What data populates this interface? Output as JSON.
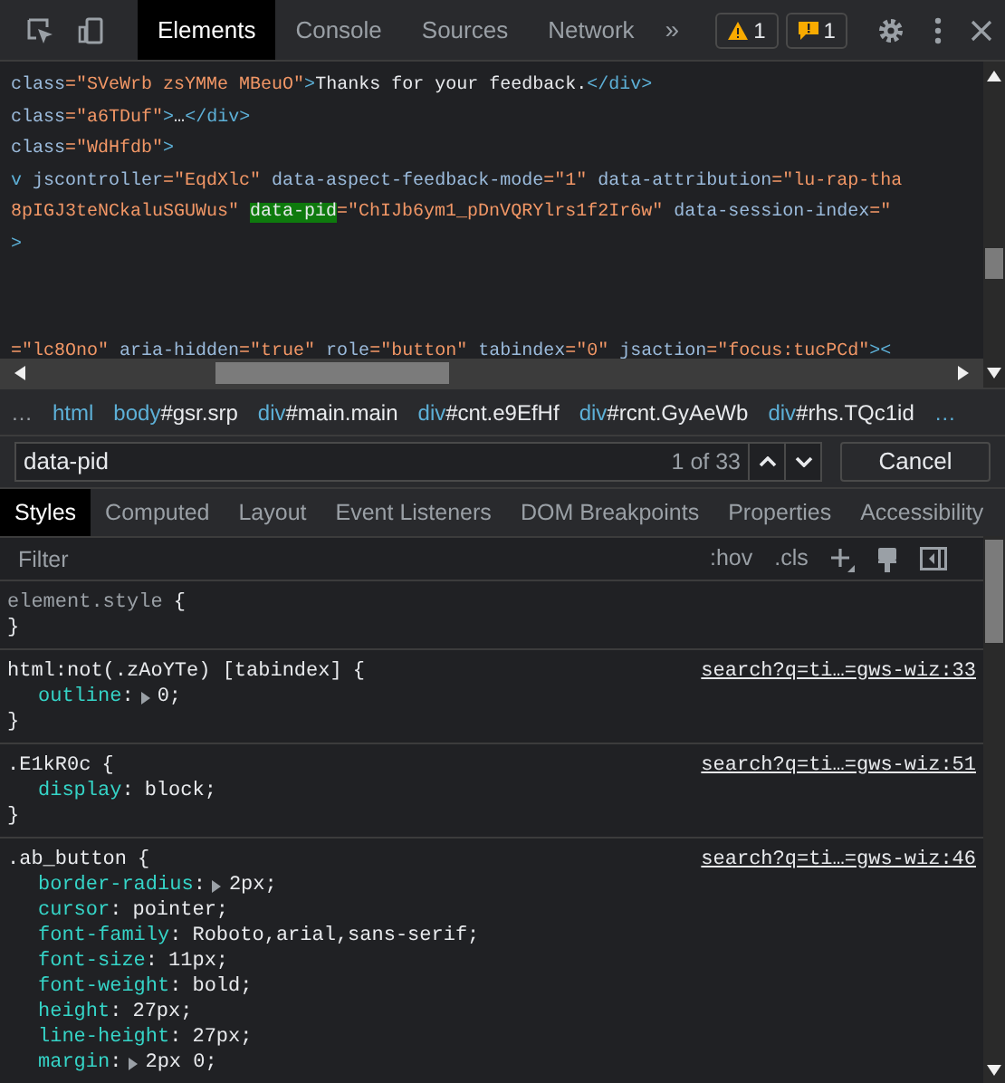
{
  "toolbar": {
    "tabs": [
      {
        "label": "Elements",
        "selected": true
      },
      {
        "label": "Console",
        "selected": false
      },
      {
        "label": "Sources",
        "selected": false
      },
      {
        "label": "Network",
        "selected": false
      }
    ],
    "more": "»",
    "warnings": "1",
    "issues": "1"
  },
  "dom_lines": [
    [
      {
        "kind": "attr",
        "text": "class"
      },
      {
        "kind": "value",
        "text": "=\"SVeWrb zsYMMe MBeuO\""
      },
      {
        "kind": "tag",
        "text": ">"
      },
      {
        "kind": "text",
        "text": "Thanks for your feedback."
      },
      {
        "kind": "tag",
        "text": "</div>"
      }
    ],
    [
      {
        "kind": "attr",
        "text": "class"
      },
      {
        "kind": "value",
        "text": "=\"a6TDuf\""
      },
      {
        "kind": "tag",
        "text": ">"
      },
      {
        "kind": "text",
        "text": "…"
      },
      {
        "kind": "tag",
        "text": "</div>"
      }
    ],
    [
      {
        "kind": "attr",
        "text": "class"
      },
      {
        "kind": "value",
        "text": "=\"WdHfdb\""
      },
      {
        "kind": "tag",
        "text": ">"
      }
    ],
    [
      {
        "kind": "tag",
        "text": "v"
      },
      {
        "kind": "attr",
        "text": " jscontroller"
      },
      {
        "kind": "value",
        "text": "=\"EqdXlc\""
      },
      {
        "kind": "attr",
        "text": " data-aspect-feedback-mode"
      },
      {
        "kind": "value",
        "text": "=\"1\""
      },
      {
        "kind": "attr",
        "text": " data-attribution"
      },
      {
        "kind": "value",
        "text": "=\"lu-rap-tha"
      }
    ],
    [
      {
        "kind": "value",
        "text": "8pIGJ3teNCkaluSGUWus\" "
      },
      {
        "kind": "match",
        "text": "data-pid"
      },
      {
        "kind": "value",
        "text": "=\"ChIJb6ym1_pDnVQRYlrs1f2Ir6w\""
      },
      {
        "kind": "attr",
        "text": " data-session-index"
      },
      {
        "kind": "value",
        "text": "=\""
      }
    ],
    [
      {
        "kind": "tag",
        "text": ">"
      }
    ]
  ],
  "dom_last_line": [
    {
      "kind": "value",
      "text": "=\"lc8Ono\""
    },
    {
      "kind": "attr",
      "text": " aria-hidden"
    },
    {
      "kind": "value",
      "text": "=\"true\""
    },
    {
      "kind": "attr",
      "text": " role"
    },
    {
      "kind": "value",
      "text": "=\"button\""
    },
    {
      "kind": "attr",
      "text": " tabindex"
    },
    {
      "kind": "value",
      "text": "=\"0\""
    },
    {
      "kind": "attr",
      "text": " jsaction"
    },
    {
      "kind": "value",
      "text": "=\"focus:tucPCd\""
    },
    {
      "kind": "tag",
      "text": "><"
    }
  ],
  "breadcrumbs": {
    "more_left": "…",
    "more_right": "…",
    "items": [
      {
        "tag": "html"
      },
      {
        "tag": "body",
        "rest": "#gsr.srp"
      },
      {
        "tag": "div",
        "rest": "#main.main"
      },
      {
        "tag": "div",
        "rest": "#cnt.e9EfHf"
      },
      {
        "tag": "div",
        "rest": "#rcnt.GyAeWb"
      },
      {
        "tag": "div",
        "rest": "#rhs.TQc1id"
      }
    ]
  },
  "search": {
    "value": "data-pid",
    "count": "1 of 33",
    "cancel": "Cancel"
  },
  "style_tabs": [
    {
      "label": "Styles",
      "selected": true
    },
    {
      "label": "Computed",
      "selected": false
    },
    {
      "label": "Layout",
      "selected": false
    },
    {
      "label": "Event Listeners",
      "selected": false
    },
    {
      "label": "DOM Breakpoints",
      "selected": false
    },
    {
      "label": "Properties",
      "selected": false
    },
    {
      "label": "Accessibility",
      "selected": false
    }
  ],
  "filter": {
    "placeholder": "Filter",
    "hov": ":hov",
    "cls": ".cls"
  },
  "rules": [
    {
      "kind": "inline",
      "selector": "element.style",
      "open": "{",
      "close": "}"
    },
    {
      "kind": "matched",
      "selector": "html:not(.zAoYTe) [tabindex]",
      "open": "{",
      "close": "}",
      "source": "search?q=ti…=gws-wiz:33",
      "declarations": [
        {
          "property": "outline",
          "colon": ":",
          "value": "0;",
          "expandable": true
        }
      ]
    },
    {
      "kind": "matched",
      "selector": ".E1kR0c",
      "open": "{",
      "close": "}",
      "source": "search?q=ti…=gws-wiz:51",
      "declarations": [
        {
          "property": "display",
          "colon": ":",
          "value": "block;"
        }
      ]
    },
    {
      "kind": "matched",
      "selector": ".ab_button",
      "open": "{",
      "source": "search?q=ti…=gws-wiz:46",
      "declarations": [
        {
          "property": "border-radius",
          "colon": ":",
          "value": "2px;",
          "expandable": true
        },
        {
          "property": "cursor",
          "colon": ":",
          "value": "pointer;"
        },
        {
          "property": "font-family",
          "colon": ":",
          "value": "Roboto,arial,sans-serif;"
        },
        {
          "property": "font-size",
          "colon": ":",
          "value": "11px;"
        },
        {
          "property": "font-weight",
          "colon": ":",
          "value": "bold;"
        },
        {
          "property": "height",
          "colon": ":",
          "value": "27px;"
        },
        {
          "property": "line-height",
          "colon": ":",
          "value": "27px;"
        },
        {
          "property": "margin",
          "colon": ":",
          "value": "2px 0;",
          "expandable": true
        }
      ]
    }
  ]
}
